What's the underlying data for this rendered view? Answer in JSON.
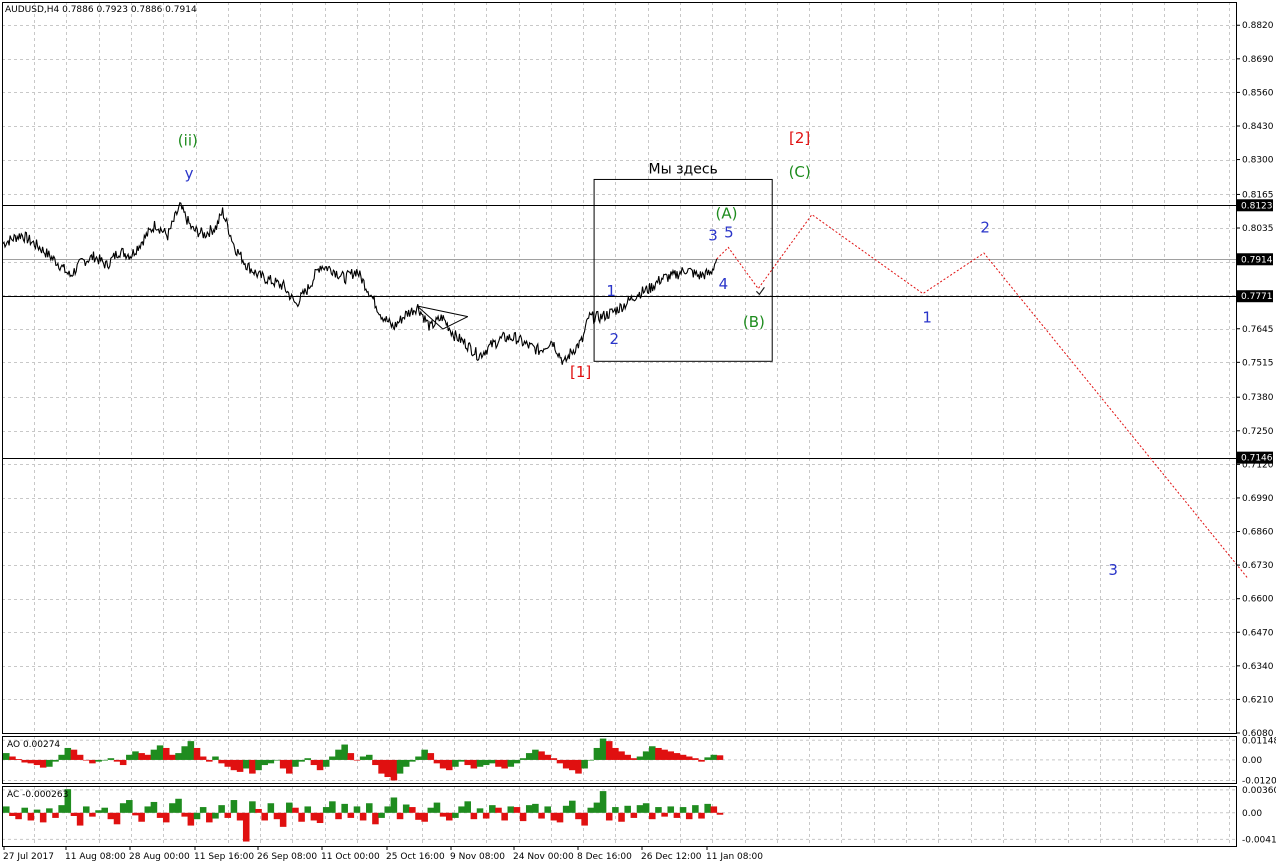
{
  "window": {
    "symbol_info": "AUDUSD,H4  0.7886 0.7923 0.7886 0.7914"
  },
  "indicators": {
    "ao": {
      "title": "AO 0.00274",
      "ticks": [
        "0.01148",
        "0.00",
        "-0.01204"
      ]
    },
    "ac": {
      "title": "AC -0.000263",
      "ticks": [
        "0.003601",
        "0.00",
        "-0.00417"
      ]
    }
  },
  "colors": {
    "price": "#000000",
    "grid": "#c8c8c8",
    "up_bar": "#1f8c1f",
    "down_bar": "#e01010",
    "forecast": "#e01010",
    "wave_blue": "#2a35c9",
    "wave_green": "#1e8c1e",
    "wave_red": "#e01010"
  },
  "chart_data": {
    "type": "line",
    "title": "AUDUSD,H4",
    "x_ticks": [
      "27 Jul 2017",
      "11 Aug 08:00",
      "28 Aug 00:00",
      "11 Sep 16:00",
      "26 Sep 08:00",
      "11 Oct 00:00",
      "25 Oct 16:00",
      "9 Nov 08:00",
      "24 Nov 00:00",
      "8 Dec 16:00",
      "26 Dec 12:00",
      "11 Jan 08:00"
    ],
    "y_ticks": [
      "0.8820",
      "0.8690",
      "0.8560",
      "0.8430",
      "0.8300",
      "0.8165",
      "0.8035",
      "0.7905",
      "0.7775",
      "0.7645",
      "0.7515",
      "0.7380",
      "0.7250",
      "0.7120",
      "0.6990",
      "0.6860",
      "0.6730",
      "0.6600",
      "0.6470",
      "0.6340",
      "0.6210",
      "0.6080"
    ],
    "ylim": [
      0.608,
      0.891
    ],
    "price_markers": {
      "current": "0.7914",
      "levels": [
        "0.8123",
        "0.7771",
        "0.7146"
      ]
    },
    "price_series": [
      {
        "x": 0,
        "y": 0.7975
      },
      {
        "x": 3,
        "y": 0.801
      },
      {
        "x": 6,
        "y": 0.796
      },
      {
        "x": 9,
        "y": 0.79
      },
      {
        "x": 11,
        "y": 0.785
      },
      {
        "x": 13,
        "y": 0.7905
      },
      {
        "x": 15,
        "y": 0.7925
      },
      {
        "x": 17,
        "y": 0.789
      },
      {
        "x": 19,
        "y": 0.7945
      },
      {
        "x": 21,
        "y": 0.793
      },
      {
        "x": 23,
        "y": 0.799
      },
      {
        "x": 25,
        "y": 0.805
      },
      {
        "x": 27,
        "y": 0.8005
      },
      {
        "x": 29,
        "y": 0.812
      },
      {
        "x": 31,
        "y": 0.803
      },
      {
        "x": 33,
        "y": 0.801
      },
      {
        "x": 35,
        "y": 0.804
      },
      {
        "x": 36,
        "y": 0.81
      },
      {
        "x": 38,
        "y": 0.796
      },
      {
        "x": 40,
        "y": 0.789
      },
      {
        "x": 42,
        "y": 0.785
      },
      {
        "x": 44,
        "y": 0.783
      },
      {
        "x": 46,
        "y": 0.781
      },
      {
        "x": 48,
        "y": 0.774
      },
      {
        "x": 50,
        "y": 0.78
      },
      {
        "x": 52,
        "y": 0.789
      },
      {
        "x": 54,
        "y": 0.7875
      },
      {
        "x": 56,
        "y": 0.784
      },
      {
        "x": 58,
        "y": 0.787
      },
      {
        "x": 60,
        "y": 0.779
      },
      {
        "x": 62,
        "y": 0.77
      },
      {
        "x": 64,
        "y": 0.765
      },
      {
        "x": 66,
        "y": 0.77
      },
      {
        "x": 68,
        "y": 0.773
      },
      {
        "x": 70,
        "y": 0.765
      },
      {
        "x": 72,
        "y": 0.769
      },
      {
        "x": 74,
        "y": 0.762
      },
      {
        "x": 76,
        "y": 0.7585
      },
      {
        "x": 78,
        "y": 0.754
      },
      {
        "x": 80,
        "y": 0.758
      },
      {
        "x": 82,
        "y": 0.761
      },
      {
        "x": 84,
        "y": 0.761
      },
      {
        "x": 86,
        "y": 0.758
      },
      {
        "x": 88,
        "y": 0.756
      },
      {
        "x": 90,
        "y": 0.76
      },
      {
        "x": 92,
        "y": 0.751
      },
      {
        "x": 93,
        "y": 0.755
      },
      {
        "x": 95,
        "y": 0.76
      },
      {
        "x": 96,
        "y": 0.769
      },
      {
        "x": 98,
        "y": 0.769
      },
      {
        "x": 100,
        "y": 0.771
      },
      {
        "x": 102,
        "y": 0.774
      },
      {
        "x": 104,
        "y": 0.778
      },
      {
        "x": 106,
        "y": 0.78
      },
      {
        "x": 108,
        "y": 0.784
      },
      {
        "x": 110,
        "y": 0.785
      },
      {
        "x": 112,
        "y": 0.7875
      },
      {
        "x": 114,
        "y": 0.785
      },
      {
        "x": 116,
        "y": 0.786
      },
      {
        "x": 117,
        "y": 0.7915
      }
    ],
    "forecast_path": [
      {
        "x": 117,
        "y": 0.7915
      },
      {
        "x": 118.9,
        "y": 0.796
      },
      {
        "x": 123.8,
        "y": 0.78
      },
      {
        "x": 132.6,
        "y": 0.8087
      },
      {
        "x": 150.8,
        "y": 0.7781
      },
      {
        "x": 160.8,
        "y": 0.7938
      },
      {
        "x": 204,
        "y": 0.6681
      }
    ],
    "trend_lines": [
      {
        "x1": 67.9,
        "y1": 0.7733,
        "x2": 76.2,
        "y2": 0.7692
      },
      {
        "x1": 67.9,
        "y1": 0.7733,
        "x2": 72.1,
        "y2": 0.7644
      },
      {
        "x1": 72.1,
        "y1": 0.7644,
        "x2": 76.2,
        "y2": 0.7692
      }
    ],
    "box": {
      "x1": 96.9,
      "y1": 0.8223,
      "x2": 126.1,
      "y2": 0.7519,
      "label": "Мы здесь"
    },
    "wave_labels": [
      {
        "text": "(ii)",
        "color": "green",
        "x": 30.3,
        "y": 0.8371
      },
      {
        "text": "y",
        "color": "blue",
        "x": 30.5,
        "y": 0.8245
      },
      {
        "text": "[1]",
        "color": "red",
        "x": 94.7,
        "y": 0.7476
      },
      {
        "text": "1",
        "color": "blue",
        "x": 99.7,
        "y": 0.779
      },
      {
        "text": "2",
        "color": "blue",
        "x": 100.2,
        "y": 0.7604
      },
      {
        "text": "3",
        "color": "blue",
        "x": 116.4,
        "y": 0.8004
      },
      {
        "text": "4",
        "color": "blue",
        "x": 118.1,
        "y": 0.7817
      },
      {
        "text": "5",
        "color": "blue",
        "x": 119.0,
        "y": 0.8015
      },
      {
        "text": "(A)",
        "color": "green",
        "x": 118.6,
        "y": 0.8089
      },
      {
        "text": "(B)",
        "color": "green",
        "x": 123.1,
        "y": 0.767
      },
      {
        "text": "[2]",
        "color": "red",
        "x": 130.6,
        "y": 0.8382
      },
      {
        "text": "(C)",
        "color": "green",
        "x": 130.6,
        "y": 0.825
      },
      {
        "text": "2",
        "color": "blue",
        "x": 161.0,
        "y": 0.8035
      },
      {
        "text": "1",
        "color": "blue",
        "x": 151.5,
        "y": 0.7687
      },
      {
        "text": "3",
        "color": "blue",
        "x": 182.0,
        "y": 0.671
      }
    ],
    "ao_range": [
      -0.0135,
      0.014
    ],
    "ao_values": [
      0.004,
      0.002,
      0.0005,
      -0.0015,
      -0.002,
      -0.003,
      -0.0045,
      -0.004,
      -0.001,
      0.003,
      0.007,
      0.006,
      0.003,
      0.0,
      -0.002,
      -0.001,
      0.0,
      0.001,
      -0.001,
      -0.003,
      0.003,
      0.005,
      0.004,
      0.003,
      0.006,
      0.0085,
      0.007,
      0.003,
      0.004,
      0.008,
      0.011,
      0.007,
      0.002,
      -0.001,
      0.002,
      -0.002,
      -0.004,
      -0.006,
      -0.007,
      -0.005,
      -0.008,
      -0.006,
      -0.003,
      -0.002,
      0.0,
      -0.005,
      -0.008,
      -0.004,
      -0.001,
      0.001,
      -0.003,
      -0.006,
      -0.004,
      0.002,
      0.006,
      0.009,
      0.004,
      0.0,
      0.002,
      0.003,
      -0.003,
      -0.008,
      -0.01,
      -0.012,
      -0.008,
      -0.004,
      -0.001,
      0.002,
      0.006,
      0.004,
      -0.002,
      -0.005,
      -0.006,
      -0.004,
      -0.001,
      -0.003,
      -0.005,
      -0.004,
      -0.003,
      -0.002,
      -0.004,
      -0.005,
      -0.004,
      -0.002,
      0.001,
      0.004,
      0.006,
      0.005,
      0.003,
      0.001,
      -0.002,
      -0.005,
      -0.006,
      -0.008,
      -0.005,
      0.0,
      0.007,
      0.0125,
      0.011,
      0.007,
      0.005,
      0.003,
      0.001,
      0.002,
      0.005,
      0.008,
      0.007,
      0.006,
      0.005,
      0.004,
      0.003,
      0.002,
      0.001,
      -0.001,
      0.0015,
      0.003,
      0.0027
    ],
    "ac_range": [
      -0.0052,
      0.0042
    ],
    "ac_values": [
      0.001,
      -0.0005,
      -0.001,
      0.0008,
      -0.0012,
      0.0005,
      -0.0015,
      0.0007,
      -0.0008,
      0.0012,
      0.0037,
      -0.0005,
      -0.002,
      0.001,
      -0.0006,
      0.0004,
      0.0008,
      -0.001,
      -0.0018,
      0.0015,
      0.002,
      -0.0004,
      -0.0014,
      0.001,
      0.0017,
      -0.0008,
      -0.0015,
      0.0015,
      0.0022,
      -0.0006,
      -0.002,
      -0.001,
      0.0009,
      -0.0015,
      -0.0009,
      0.0012,
      -0.0008,
      0.002,
      -0.0012,
      -0.0045,
      0.0018,
      0.0006,
      -0.0012,
      0.0015,
      -0.001,
      -0.0022,
      0.0016,
      0.0008,
      -0.0014,
      0.001,
      -0.0012,
      -0.0016,
      0.0009,
      0.0018,
      -0.001,
      0.0014,
      -0.0008,
      0.001,
      -0.0012,
      0.0015,
      -0.0018,
      -0.0008,
      0.001,
      0.0024,
      -0.001,
      0.0013,
      0.0009,
      -0.0011,
      -0.0014,
      0.0008,
      0.0016,
      -0.0006,
      -0.0012,
      -0.0008,
      0.001,
      0.0018,
      -0.001,
      0.0007,
      -0.0009,
      0.0012,
      0.0008,
      -0.0012,
      0.001,
      0.0009,
      -0.0013,
      0.0012,
      0.0014,
      -0.0009,
      0.001,
      -0.0012,
      -0.0015,
      0.0011,
      0.0019,
      -0.001,
      -0.002,
      0.0008,
      0.0016,
      0.0034,
      -0.0012,
      0.0009,
      -0.0014,
      0.0011,
      -0.0008,
      0.0012,
      0.0015,
      -0.001,
      0.0009,
      -0.0006,
      0.001,
      -0.0008,
      0.0009,
      -0.001,
      0.0012,
      -0.0009,
      0.0014,
      0.001,
      -0.0003
    ]
  }
}
